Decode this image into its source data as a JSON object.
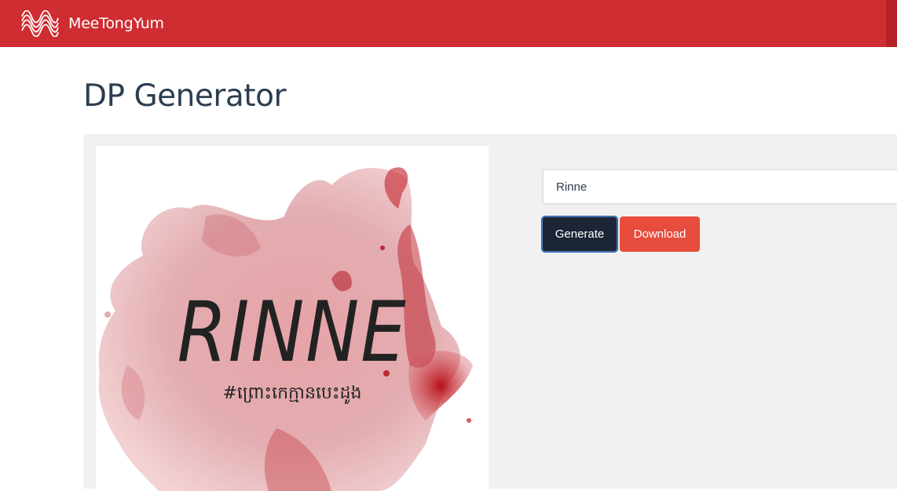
{
  "navbar": {
    "brand": "MeeTongYum",
    "logo_icon": "waveform-logo-icon",
    "color": "#cf2d31"
  },
  "page": {
    "title": "DP Generator"
  },
  "preview": {
    "name_text": "RINNE",
    "tagline": "#ព្រោះកេក្មានបេះដូង",
    "background": "red-watercolor-splash",
    "accent_color": "#c0151d"
  },
  "form": {
    "name_value": "Rinne",
    "generate_label": "Generate",
    "download_label": "Download",
    "generate_color": "#1b2535",
    "download_color": "#e74c3c"
  }
}
